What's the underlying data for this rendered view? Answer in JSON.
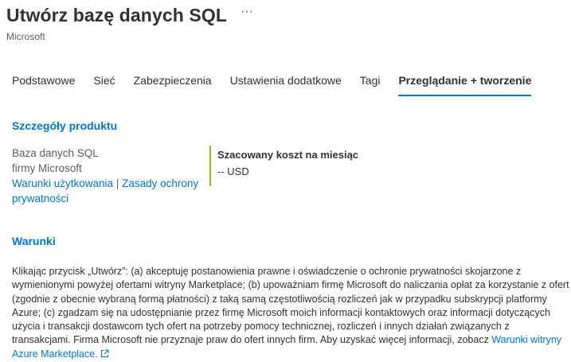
{
  "header": {
    "title": "Utwórz bazę danych SQL",
    "more_label": "···",
    "publisher": "Microsoft"
  },
  "tabs": [
    {
      "label": "Podstawowe",
      "active": false
    },
    {
      "label": "Sieć",
      "active": false
    },
    {
      "label": "Zabezpieczenia",
      "active": false
    },
    {
      "label": "Ustawienia dodatkowe",
      "active": false
    },
    {
      "label": "Tagi",
      "active": false
    },
    {
      "label": "Przeglądanie + tworzenie",
      "active": true
    }
  ],
  "product": {
    "heading": "Szczegóły produktu",
    "name_line1": "Baza danych SQL",
    "name_line2": "firmy Microsoft",
    "terms_link": "Warunki użytkowania",
    "separator": "|",
    "privacy_link": "Zasady ochrony prywatności"
  },
  "cost": {
    "label": "Szacowany koszt na miesiąc",
    "value": "-- USD"
  },
  "terms": {
    "heading": "Warunki",
    "body": "Klikając przycisk „Utwórz”: (a) akceptuję postanowienia prawne i oświadczenie o ochronie prywatności skojarzone z wymienionymi powyżej ofertami witryny Marketplace; (b) upoważniam firmę Microsoft do naliczania opłat za korzystanie z ofert (zgodnie z obecnie wybraną formą płatności) z taką samą częstotliwością rozliczeń jak w przypadku subskrypcji platformy Azure; (c) zgadzam się na udostępnianie przez firmę Microsoft moich informacji kontaktowych oraz informacji dotyczących użycia i transakcji dostawcom tych ofert na potrzeby pomocy technicznej, rozliczeń i innych działań związanych z transakcjami. Firma Microsoft nie przyznaje praw do ofert innych firm. Aby uzyskać więcej informacji, zobacz ",
    "link": "Warunki witryny Azure Marketplace."
  },
  "colors": {
    "accent": "#0078d4",
    "cost_border": "#8cbd18"
  }
}
